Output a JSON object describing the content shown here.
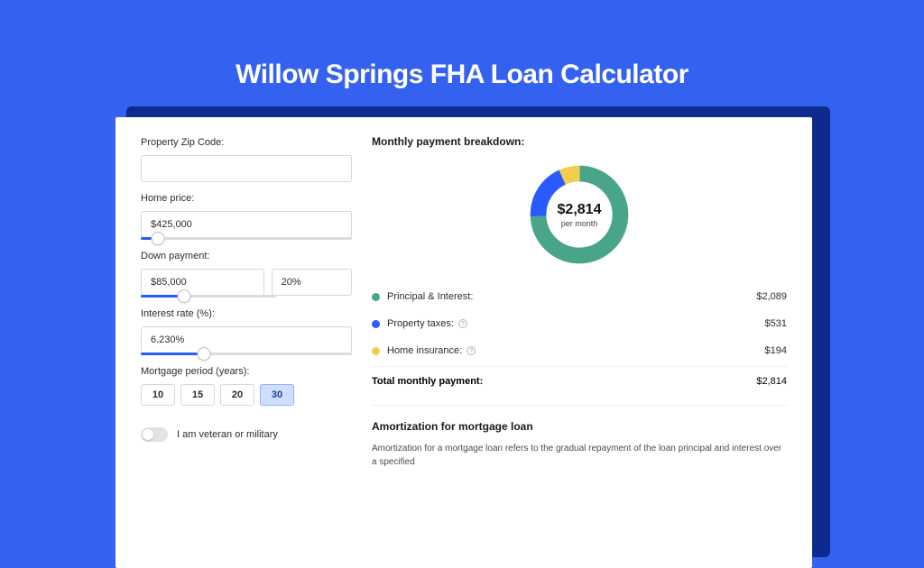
{
  "title": "Willow Springs FHA Loan Calculator",
  "form": {
    "zip": {
      "label": "Property Zip Code:",
      "value": ""
    },
    "home_price": {
      "label": "Home price:",
      "value": "$425,000",
      "slider_pct": 8
    },
    "down_payment": {
      "label": "Down payment:",
      "amount": "$85,000",
      "pct": "20%",
      "slider_pct": 20
    },
    "interest": {
      "label": "Interest rate (%):",
      "value": "6.230%",
      "slider_pct": 30
    },
    "period": {
      "label": "Mortgage period (years):",
      "options": [
        "10",
        "15",
        "20",
        "30"
      ],
      "selected": "30"
    },
    "veteran": {
      "label": "I am veteran or military",
      "on": false
    }
  },
  "breakdown": {
    "heading": "Monthly payment breakdown:",
    "center_amount": "$2,814",
    "center_label": "per month",
    "items": [
      {
        "label": "Principal & Interest:",
        "value": "$2,089",
        "color": "#49a58a",
        "has_info": false
      },
      {
        "label": "Property taxes:",
        "value": "$531",
        "color": "#2a5bff",
        "has_info": true
      },
      {
        "label": "Home insurance:",
        "value": "$194",
        "color": "#f1cf4d",
        "has_info": true
      }
    ],
    "total_label": "Total monthly payment:",
    "total_value": "$2,814"
  },
  "chart_data": {
    "type": "pie",
    "title": "Monthly payment breakdown",
    "series": [
      {
        "name": "Principal & Interest",
        "value": 2089,
        "color": "#49a58a"
      },
      {
        "name": "Property taxes",
        "value": 531,
        "color": "#2a5bff"
      },
      {
        "name": "Home insurance",
        "value": 194,
        "color": "#f1cf4d"
      }
    ],
    "total": 2814,
    "center_label": "per month"
  },
  "amortization": {
    "heading": "Amortization for mortgage loan",
    "text": "Amortization for a mortgage loan refers to the gradual repayment of the loan principal and interest over a specified"
  }
}
